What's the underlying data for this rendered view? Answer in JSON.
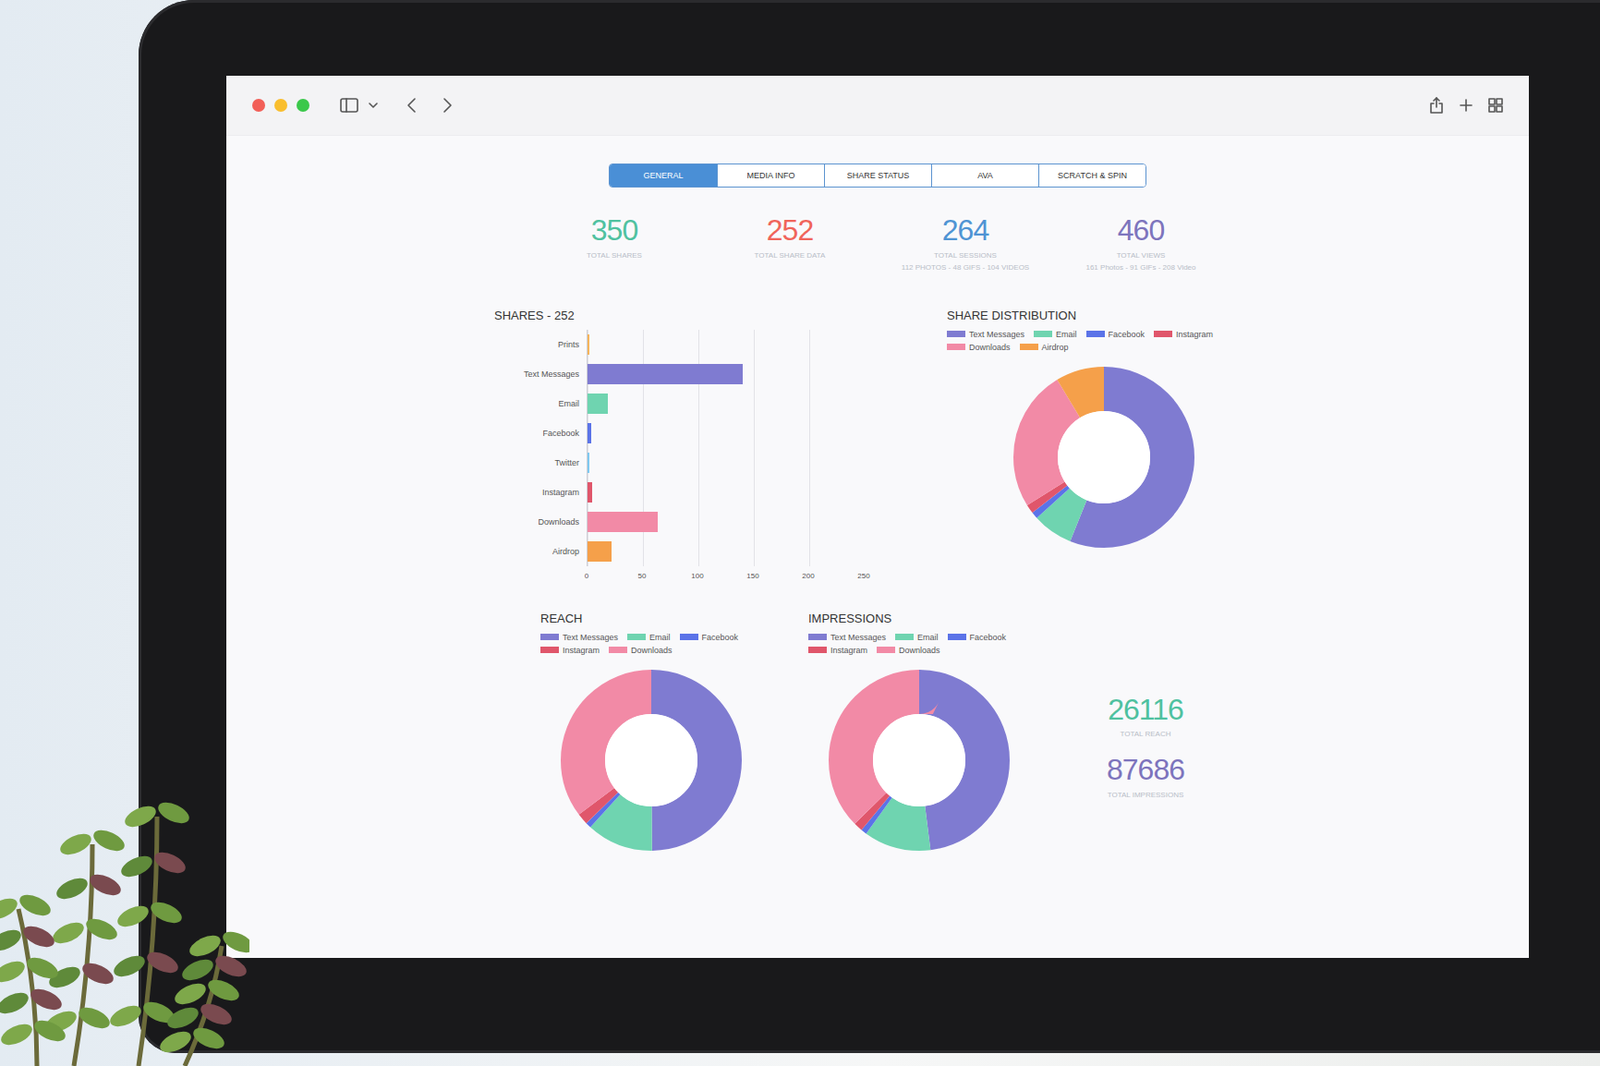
{
  "tabs": [
    {
      "label": "GENERAL",
      "selected": true
    },
    {
      "label": "MEDIA INFO",
      "selected": false
    },
    {
      "label": "SHARE STATUS",
      "selected": false
    },
    {
      "label": "AVA",
      "selected": false
    },
    {
      "label": "SCRATCH & SPIN",
      "selected": false
    }
  ],
  "stats": [
    {
      "value": "350",
      "label": "TOTAL SHARES",
      "color": "#4fc1a0"
    },
    {
      "value": "252",
      "label": "TOTAL SHARE DATA",
      "color": "#f0645a"
    },
    {
      "value": "264",
      "label": "TOTAL SESSIONS",
      "sub": "112 PHOTOS - 48 GIFS - 104 VIDEOS",
      "color": "#4f94d4"
    },
    {
      "value": "460",
      "label": "TOTAL VIEWS",
      "sub": "161 Photos - 91 GIFs - 208 Video",
      "color": "#7d74bd"
    }
  ],
  "shares_chart": {
    "title": "SHARES - 252",
    "ticks": [
      "0",
      "50",
      "100",
      "150",
      "200",
      "250"
    ],
    "bars": [
      {
        "label": "Prints",
        "value": 1,
        "color": "#f5b45a"
      },
      {
        "label": "Text Messages",
        "value": 140,
        "color": "#7f7bd1"
      },
      {
        "label": "Email",
        "value": 18,
        "color": "#6fd4b0"
      },
      {
        "label": "Facebook",
        "value": 3,
        "color": "#5b73e8"
      },
      {
        "label": "Twitter",
        "value": 1,
        "color": "#7ec8f0"
      },
      {
        "label": "Instagram",
        "value": 4,
        "color": "#e0566b"
      },
      {
        "label": "Downloads",
        "value": 63,
        "color": "#f28aa6"
      },
      {
        "label": "Airdrop",
        "value": 22,
        "color": "#f5a04a"
      }
    ]
  },
  "share_distribution": {
    "title": "SHARE DISTRIBUTION",
    "legend": [
      {
        "label": "Text Messages",
        "value": 140,
        "color": "#7f7bd1"
      },
      {
        "label": "Email",
        "value": 18,
        "color": "#6fd4b0"
      },
      {
        "label": "Facebook",
        "value": 3,
        "color": "#5b73e8"
      },
      {
        "label": "Instagram",
        "value": 4,
        "color": "#e0566b"
      },
      {
        "label": "Downloads",
        "value": 63,
        "color": "#f28aa6"
      },
      {
        "label": "Airdrop",
        "value": 22,
        "color": "#f5a04a"
      }
    ]
  },
  "reach": {
    "title": "REACH",
    "legend": [
      {
        "label": "Text Messages",
        "value": 13000,
        "color": "#7f7bd1"
      },
      {
        "label": "Email",
        "value": 3100,
        "color": "#6fd4b0"
      },
      {
        "label": "Facebook",
        "value": 260,
        "color": "#5b73e8"
      },
      {
        "label": "Instagram",
        "value": 520,
        "color": "#e0566b"
      },
      {
        "label": "Downloads",
        "value": 9236,
        "color": "#f28aa6"
      }
    ]
  },
  "impressions": {
    "title": "IMPRESSIONS",
    "legend": [
      {
        "label": "Text Messages",
        "value": 42000,
        "color": "#7f7bd1"
      },
      {
        "label": "Email",
        "value": 10500,
        "color": "#6fd4b0"
      },
      {
        "label": "Facebook",
        "value": 900,
        "color": "#5b73e8"
      },
      {
        "label": "Instagram",
        "value": 1400,
        "color": "#e0566b"
      },
      {
        "label": "Downloads",
        "value": 32886,
        "color": "#f28aa6"
      }
    ]
  },
  "totals": [
    {
      "value": "26116",
      "label": "TOTAL REACH",
      "color": "#4fc1a0"
    },
    {
      "value": "87686",
      "label": "TOTAL IMPRESSIONS",
      "color": "#7d74bd"
    }
  ]
}
